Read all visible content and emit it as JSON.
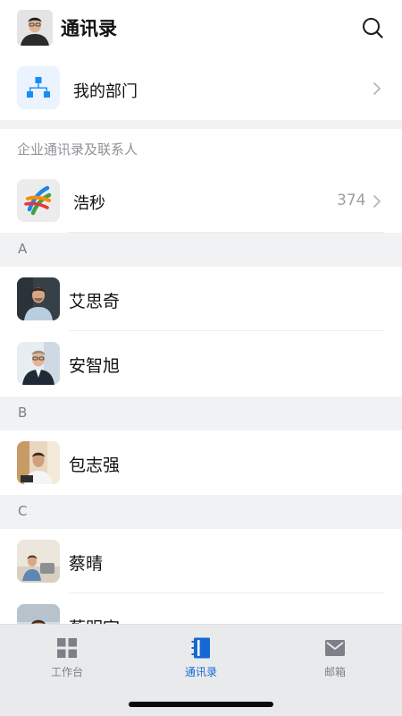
{
  "header": {
    "title": "通讯录",
    "avatar_icon": "user-avatar",
    "search_icon": "search-icon"
  },
  "my_department": {
    "label": "我的部门",
    "icon": "org-chart-icon"
  },
  "section_caption": "企业通讯录及联系人",
  "organization": {
    "name": "浩秒",
    "count": "374"
  },
  "groups": [
    {
      "letter": "A",
      "contacts": [
        {
          "name": "艾思奇"
        },
        {
          "name": "安智旭"
        }
      ]
    },
    {
      "letter": "B",
      "contacts": [
        {
          "name": "包志强"
        }
      ]
    },
    {
      "letter": "C",
      "contacts": [
        {
          "name": "蔡晴"
        },
        {
          "name": "蔡明宇"
        }
      ]
    }
  ],
  "tabbar": {
    "tabs": [
      {
        "label": "工作台",
        "icon": "grid-icon",
        "active": false
      },
      {
        "label": "通讯录",
        "icon": "contacts-book-icon",
        "active": true
      },
      {
        "label": "邮箱",
        "icon": "mail-icon",
        "active": false
      }
    ]
  },
  "colors": {
    "accent": "#1768d3",
    "dept_icon_blue": "#1a8cf5",
    "gray_bg": "#f1f2f4"
  }
}
